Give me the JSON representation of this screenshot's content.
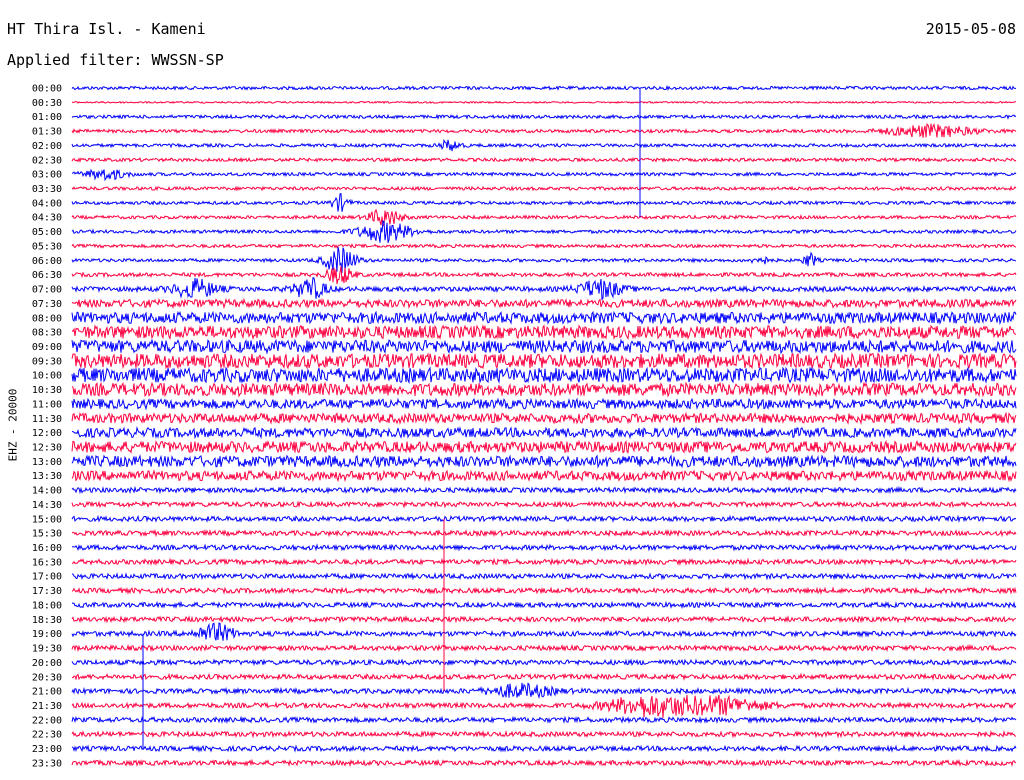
{
  "header": {
    "title": "HT Thira Isl. - Kameni",
    "date": "2015-05-08",
    "filter": "Applied filter: WWSSN-SP"
  },
  "side_label": "EHZ - 20000",
  "colors": {
    "trace_a": "#0000ff",
    "trace_b": "#ff0040",
    "text": "#000000",
    "background": "#ffffff"
  },
  "chart_data": {
    "type": "seismogram-helicorder",
    "y_ticks": [
      "00:00",
      "00:30",
      "01:00",
      "01:30",
      "02:00",
      "02:30",
      "03:00",
      "03:30",
      "04:00",
      "04:30",
      "05:00",
      "05:30",
      "06:00",
      "06:30",
      "07:00",
      "07:30",
      "08:00",
      "08:30",
      "09:00",
      "09:30",
      "10:00",
      "10:30",
      "11:00",
      "11:30",
      "12:00",
      "12:30",
      "13:00",
      "13:30",
      "14:00",
      "14:30",
      "15:00",
      "15:30",
      "16:00",
      "16:30",
      "17:00",
      "17:30",
      "18:00",
      "18:30",
      "19:00",
      "19:30",
      "20:00",
      "20:30",
      "21:00",
      "21:30",
      "22:00",
      "22:30",
      "23:00",
      "23:30"
    ],
    "trace_colors_alternate": [
      "trace_a",
      "trace_b"
    ],
    "relative_noise_amplitude": [
      1,
      0.5,
      1,
      1,
      1,
      1,
      1,
      1,
      1,
      1,
      1,
      1,
      1,
      1.2,
      1.5,
      2.5,
      3.5,
      4,
      4,
      4.5,
      4.5,
      4,
      3,
      3,
      3,
      3.5,
      3.5,
      3,
      1.5,
      1.5,
      1.5,
      1.5,
      1.5,
      1.5,
      1.5,
      1.5,
      1.5,
      1.5,
      1.5,
      1.5,
      1.5,
      1.5,
      1.5,
      1.5,
      1.5,
      1.5,
      1.5,
      1.5
    ]
  }
}
